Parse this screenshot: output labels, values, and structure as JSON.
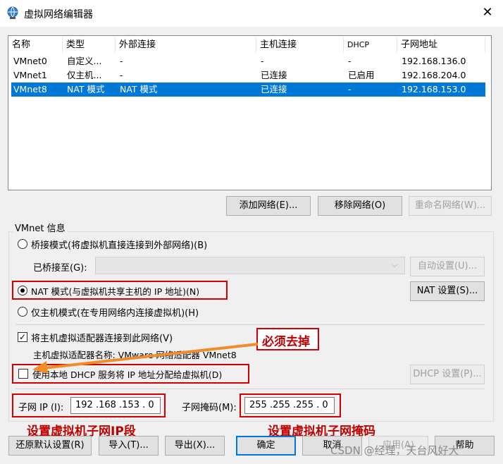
{
  "window": {
    "title": "虚拟网络编辑器",
    "close_glyph": "✕",
    "icon": "network-globe-icon"
  },
  "table": {
    "headers": [
      "名称",
      "类型",
      "外部连接",
      "主机连接",
      "DHCP",
      "子网地址"
    ],
    "rows": [
      {
        "name": "VMnet0",
        "type": "自定义...",
        "external": "-",
        "host": "-",
        "dhcp": "-",
        "subnet": "192.168.136.0",
        "selected": false
      },
      {
        "name": "VMnet1",
        "type": "仅主机...",
        "external": "-",
        "host": "已连接",
        "dhcp": "已启用",
        "subnet": "192.168.204.0",
        "selected": false
      },
      {
        "name": "VMnet8",
        "type": "NAT 模式",
        "external": "NAT 模式",
        "host": "已连接",
        "dhcp": "-",
        "subnet": "192.168.153.0",
        "selected": true
      }
    ]
  },
  "table_buttons": {
    "add": "添加网络(E)...",
    "remove": "移除网络(O)",
    "rename": "重命名网络(W)..."
  },
  "vmnet_info": {
    "group_label": "VMnet 信息",
    "bridged_label": "桥接模式(将虚拟机直接连接到外部网络)(B)",
    "bridged_to_label": "已桥接至(G):",
    "auto_settings": "自动设置(U)...",
    "nat_label": "NAT 模式(与虚拟机共享主机的 IP 地址)(N)",
    "nat_settings": "NAT 设置(S)...",
    "hostonly_label": "仅主机模式(在专用网络内连接虚拟机)(H)",
    "connect_adapter_label": "将主机虚拟适配器连接到此网络(V)",
    "adapter_name_label": "主机虚拟适配器名称: VMware 网络适配器 VMnet8",
    "dhcp_label": "使用本地 DHCP 服务将 IP 地址分配给虚拟机(D)",
    "dhcp_settings": "DHCP 设置(P)...",
    "subnet_ip_label": "子网 IP (I):",
    "subnet_ip_value": "192 .168 .153 .  0",
    "subnet_mask_label": "子网掩码(M):",
    "subnet_mask_value": "255 .255 .255 .  0",
    "connect_adapter_checked": true,
    "dhcp_checked": false
  },
  "annotations": {
    "must_remove": "必须去掉",
    "set_ip_segment": "设置虚拟机子网IP段",
    "set_mask": "设置虚拟机子网掩码",
    "color_red": "#d10000",
    "color_arrow": "#f28c28"
  },
  "bottom_buttons": {
    "restore": "还原默认设置(R)",
    "import": "导入(T)...",
    "export": "导出(X)...",
    "ok": "确定",
    "cancel": "取消",
    "apply": "应用(A)",
    "help": "帮助"
  },
  "watermark": "CSDN @经理，天台风好大",
  "colors": {
    "selection": "#0078d7",
    "window_bg": "#f0f0f0"
  }
}
